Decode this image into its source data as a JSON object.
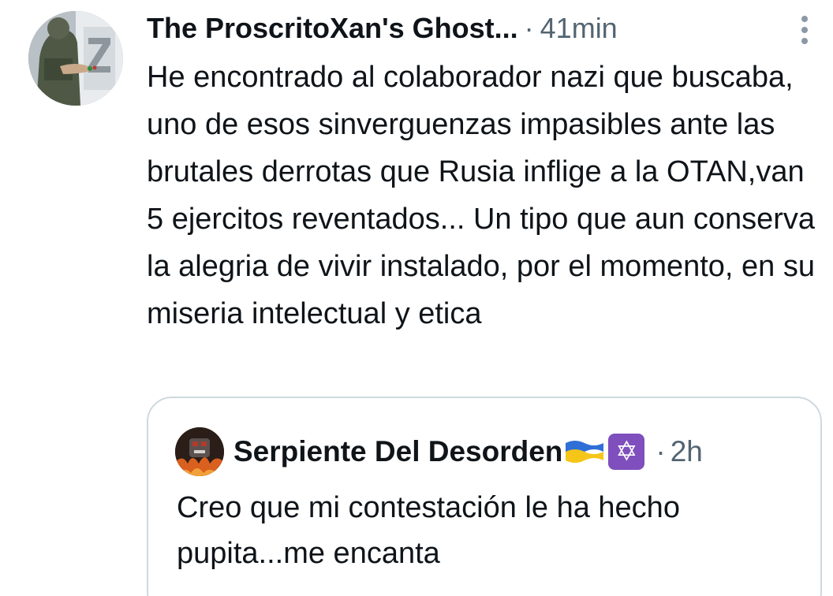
{
  "tweet": {
    "display_name": "The ProscritoXan's Ghost...",
    "separator": "·",
    "time": "41min",
    "text": "He encontrado al colaborador nazi que buscaba, uno de esos sinverguenzas impasibles ante las brutales derrotas que Rusia inflige a la OTAN,van 5 ejercitos reventados... Un tipo que aun conserva la alegria de vivir instalado, por el momento, en su miseria intelectual y etica",
    "more_icon": "more-vertical-icon"
  },
  "quoted_tweet": {
    "display_name": "Serpiente Del Desorden",
    "flag_icon": "ukraine-flag-icon",
    "star_glyph": "✡",
    "separator": "·",
    "time": "2h",
    "text": "Creo que mi contestación le ha hecho pupita...me encanta"
  },
  "colors": {
    "text": "#0f1419",
    "secondary": "#536471",
    "border": "#cfd9de"
  }
}
